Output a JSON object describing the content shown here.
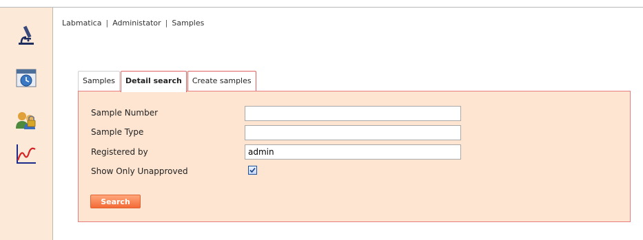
{
  "breadcrumb": {
    "items": [
      "Labmatica",
      "Administator",
      "Samples"
    ],
    "separator": "|"
  },
  "sidebar": {
    "icons": [
      {
        "name": "microscope-icon"
      },
      {
        "name": "calendar-clock-icon"
      },
      {
        "name": "user-lock-icon"
      },
      {
        "name": "chart-icon"
      }
    ]
  },
  "tabs": [
    {
      "label": "Samples",
      "active": false
    },
    {
      "label": "Detail search",
      "active": true
    },
    {
      "label": "Create samples",
      "active": false
    }
  ],
  "form": {
    "sample_number": {
      "label": "Sample Number",
      "value": ""
    },
    "sample_type": {
      "label": "Sample Type",
      "value": ""
    },
    "registered_by": {
      "label": "Registered by",
      "value": "admin"
    },
    "show_only_unapproved": {
      "label": "Show Only Unapproved",
      "checked": true
    },
    "search_label": "Search"
  },
  "colors": {
    "sidebar_bg": "#fde9d7",
    "panel_bg": "#fde5d1",
    "panel_border": "#e97c7c",
    "button": "#f36a36"
  }
}
